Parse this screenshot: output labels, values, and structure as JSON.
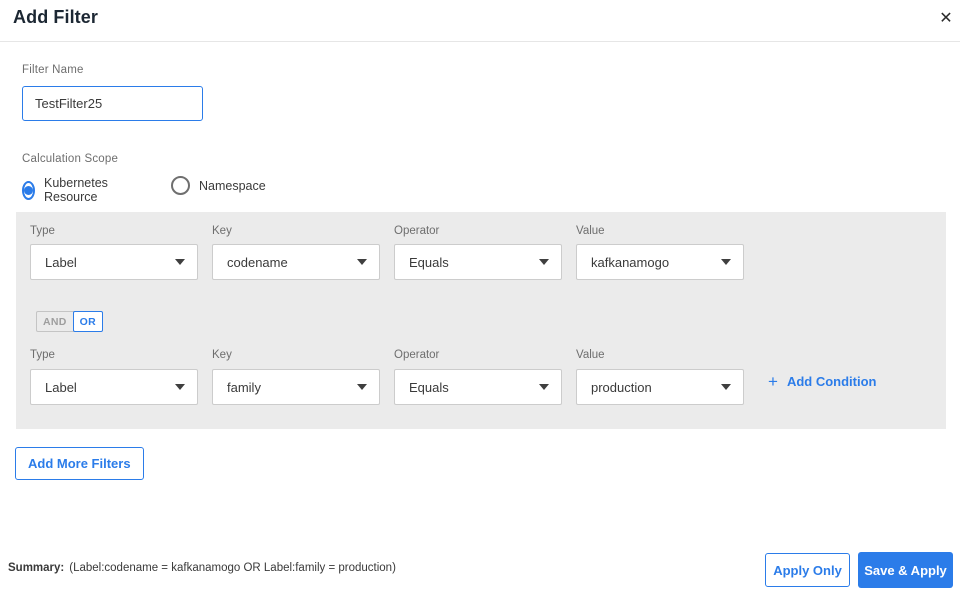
{
  "header": {
    "title": "Add Filter",
    "close_icon": "✕"
  },
  "filter_name": {
    "label": "Filter Name",
    "value": "TestFilter25"
  },
  "calculation_scope": {
    "label": "Calculation Scope",
    "options": [
      {
        "label": "Kubernetes Resource",
        "selected": true
      },
      {
        "label": "Namespace",
        "selected": false
      }
    ]
  },
  "conditions": {
    "columns": {
      "type": "Type",
      "key": "Key",
      "operator": "Operator",
      "value": "Value"
    },
    "rows": [
      {
        "type": "Label",
        "key": "codename",
        "operator": "Equals",
        "value": "kafkanamogo"
      },
      {
        "type": "Label",
        "key": "family",
        "operator": "Equals",
        "value": "production"
      }
    ],
    "logic_toggle": {
      "and_label": "AND",
      "or_label": "OR",
      "selected": "OR"
    },
    "add_condition": {
      "plus_icon": "+",
      "label": "Add Condition"
    }
  },
  "buttons": {
    "add_more_filters": "Add More Filters",
    "apply_only": "Apply Only",
    "save_apply": "Save & Apply"
  },
  "footer": {
    "summary_label": "Summary:",
    "summary_text": "(Label:codename = kafkanamogo OR Label:family = production)"
  },
  "colors": {
    "accent_blue": "#2b7ce9",
    "panel_bg": "#ebebeb",
    "title_text": "#1c2733",
    "body_text": "#3a3a3a",
    "muted_label": "#6e6e6e"
  }
}
